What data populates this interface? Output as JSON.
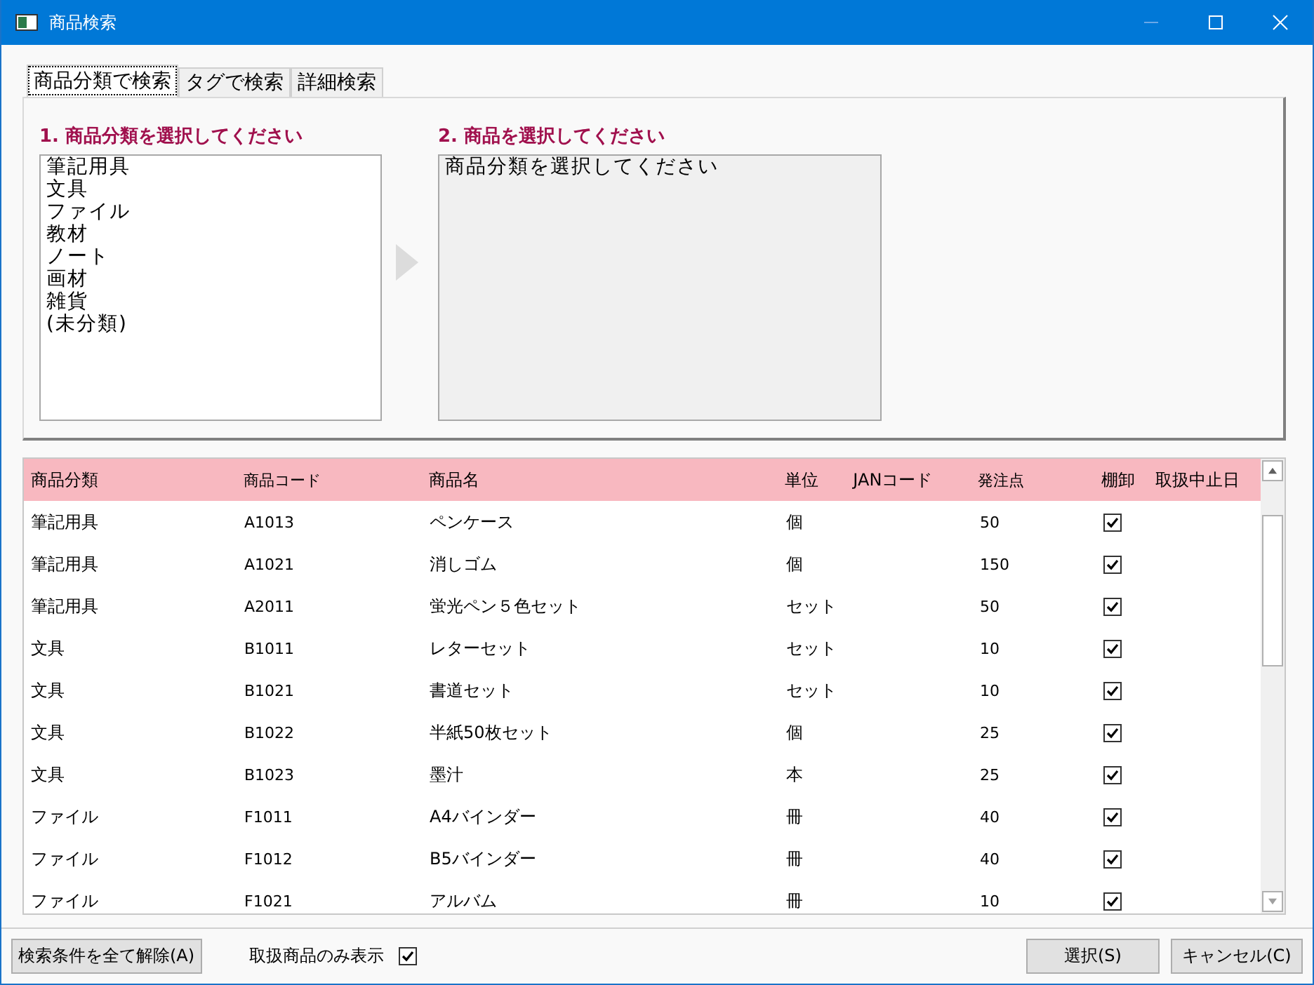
{
  "window": {
    "title": "商品検索"
  },
  "tabs": [
    {
      "label": "商品分類で検索",
      "selected": true
    },
    {
      "label": "タグで検索",
      "selected": false
    },
    {
      "label": "詳細検索",
      "selected": false
    }
  ],
  "category_panel": {
    "heading": "1. 商品分類を選択してください",
    "items": [
      "筆記用具",
      "文具",
      "ファイル",
      "教材",
      "ノート",
      "画材",
      "雑貨",
      "(未分類)"
    ]
  },
  "product_panel": {
    "heading": "2. 商品を選択してください",
    "items": [
      "商品分類を選択してください"
    ]
  },
  "table": {
    "columns": [
      "商品分類",
      "商品コード",
      "商品名",
      "単位",
      "JANコード",
      "発注点",
      "棚卸",
      "取扱中止日"
    ],
    "rows": [
      {
        "category": "筆記用具",
        "code": "A1013",
        "name": "ペンケース",
        "unit": "個",
        "reorder": "50",
        "inventory": true
      },
      {
        "category": "筆記用具",
        "code": "A1021",
        "name": "消しゴム",
        "unit": "個",
        "reorder": "150",
        "inventory": true
      },
      {
        "category": "筆記用具",
        "code": "A2011",
        "name": "蛍光ペン５色セット",
        "unit": "セット",
        "reorder": "50",
        "inventory": true
      },
      {
        "category": "文具",
        "code": "B1011",
        "name": "レターセット",
        "unit": "セット",
        "reorder": "10",
        "inventory": true
      },
      {
        "category": "文具",
        "code": "B1021",
        "name": "書道セット",
        "unit": "セット",
        "reorder": "10",
        "inventory": true
      },
      {
        "category": "文具",
        "code": "B1022",
        "name": "半紙50枚セット",
        "unit": "個",
        "reorder": "25",
        "inventory": true
      },
      {
        "category": "文具",
        "code": "B1023",
        "name": "墨汁",
        "unit": "本",
        "reorder": "25",
        "inventory": true
      },
      {
        "category": "ファイル",
        "code": "F1011",
        "name": "A4バインダー",
        "unit": "冊",
        "reorder": "40",
        "inventory": true
      },
      {
        "category": "ファイル",
        "code": "F1012",
        "name": "B5バインダー",
        "unit": "冊",
        "reorder": "40",
        "inventory": true
      },
      {
        "category": "ファイル",
        "code": "F1021",
        "name": "アルバム",
        "unit": "冊",
        "reorder": "10",
        "inventory": true
      }
    ]
  },
  "footer": {
    "clear_button": "検索条件を全て解除(A)",
    "only_active": {
      "label": "取扱商品のみ表示",
      "checked": true
    },
    "select_button": "選択(S)",
    "cancel_button": "キャンセル(C)"
  }
}
